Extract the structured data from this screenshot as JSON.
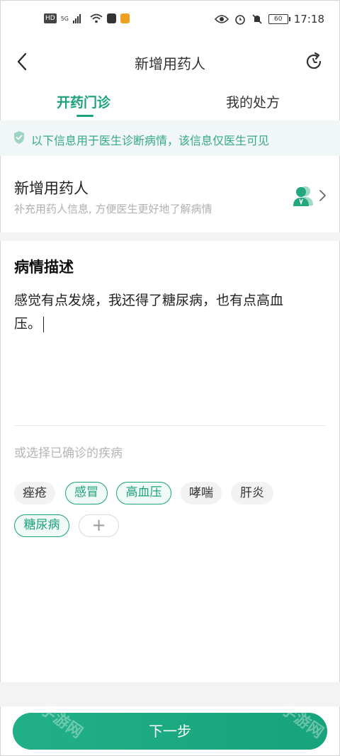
{
  "status_bar": {
    "left_badge": "HD",
    "network": "5G",
    "battery": "60",
    "time": "17:18",
    "icons": [
      "hd-badge-icon",
      "signal-icon",
      "wifi-icon",
      "app-icon",
      "app-icon",
      "eye-icon",
      "alarm-icon",
      "mute-icon",
      "battery-icon"
    ]
  },
  "nav": {
    "title": "新增用药人",
    "back_icon": "chevron-left-icon",
    "refresh_icon": "refresh-icon"
  },
  "tabs": [
    {
      "label": "开药门诊",
      "active": true
    },
    {
      "label": "我的处方",
      "active": false
    }
  ],
  "notice": {
    "text": "以下信息用于医生诊断病情，该信息仅医生可见",
    "icon": "shield-check-icon"
  },
  "patient": {
    "title": "新增用药人",
    "subtitle": "补充用药人信息, 方便医生更好地了解病情",
    "icon": "patient-avatar-icon"
  },
  "description": {
    "title": "病情描述",
    "line1": "感觉有点发烧，我还得了糖尿病，也有点高血",
    "line2": "压。"
  },
  "disease_picker": {
    "label": "或选择已确诊的疾病",
    "chips": [
      {
        "label": "痤疮",
        "selected": false
      },
      {
        "label": "感冒",
        "selected": true
      },
      {
        "label": "高血压",
        "selected": true
      },
      {
        "label": "哮喘",
        "selected": false
      },
      {
        "label": "肝炎",
        "selected": false
      },
      {
        "label": "糖尿病",
        "selected": true
      }
    ],
    "add_label": "+"
  },
  "footer": {
    "next_label": "下一步",
    "watermark": "手游网"
  },
  "colors": {
    "accent": "#1aa27a",
    "notice_bg": "#f1f7f6",
    "chip_bg": "#f2f2f2"
  }
}
